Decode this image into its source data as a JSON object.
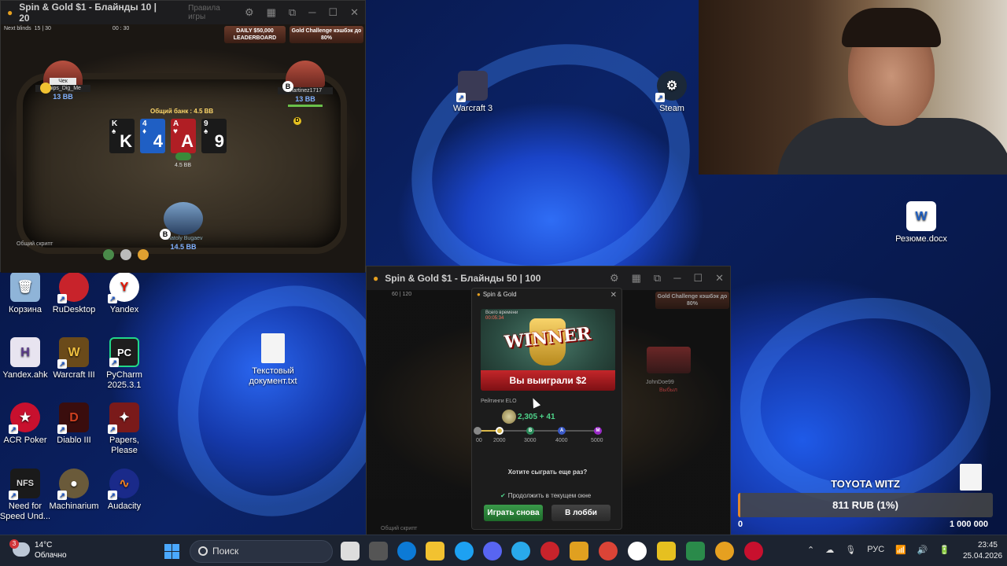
{
  "poker_window_1": {
    "title": "Spin & Gold $1 - Блайнды 10 | 20",
    "rules_link": "Правила игры",
    "next_blinds_label": "Next blinds",
    "next_blinds_value": "15 | 30",
    "timer": "00 : 30",
    "promo_1": "DAILY $50,000 LEADERBOARD",
    "promo_2": "Gold Challenge кэшбэк до 80%",
    "pot": "Общий банк : 4.5 BB",
    "players": [
      {
        "name": "Chips_Dig_Me",
        "stack": "13 BB",
        "action": "Чек"
      },
      {
        "name": "martinez1717",
        "stack": "13 BB"
      },
      {
        "name": "Anatoly Bugaev",
        "stack": "14.5 BB"
      }
    ],
    "board": [
      {
        "rank": "K",
        "suit": "♠",
        "color": "#1a1a1a"
      },
      {
        "rank": "4",
        "suit": "♦",
        "color": "#1f5fc4"
      },
      {
        "rank": "A",
        "suit": "♥",
        "color": "#b01e24"
      },
      {
        "rank": "9",
        "suit": "♠",
        "color": "#1a1a1a"
      }
    ],
    "bet": "4.5 BB",
    "chat_label": "Общий скрипт"
  },
  "desktop_icons": [
    {
      "label": "Warcraft 3",
      "color": "#3a3a55"
    },
    {
      "label": "Steam",
      "color": "#1b2838"
    },
    {
      "label": "Резюме.docx",
      "color": "#1e5fc2"
    },
    {
      "label": "Корзина",
      "color": "#8fb4d8"
    },
    {
      "label": "RuDesktop",
      "color": "#c8232b"
    },
    {
      "label": "Yandex",
      "color": "#ffffff"
    },
    {
      "label": "Yandex.ahk",
      "color": "#e8e4f0"
    },
    {
      "label": "Warcraft III",
      "color": "#6a4a1a"
    },
    {
      "label": "PyCharm 2025.3.1",
      "color": "#1e1e1e"
    },
    {
      "label": "Текстовый документ.txt",
      "color": "#f4f4f4"
    },
    {
      "label": "ACR Poker",
      "color": "#c8102e"
    },
    {
      "label": "Diablo III",
      "color": "#3a0d0d"
    },
    {
      "label": "Papers, Please",
      "color": "#7a1a1a"
    },
    {
      "label": "Need for Speed Und...",
      "color": "#1a1a1a"
    },
    {
      "label": "Machinarium",
      "color": "#6a5a3a"
    },
    {
      "label": "Audacity",
      "color": "#1a2a8a"
    }
  ],
  "poker_window_2": {
    "title": "Spin & Gold $1 - Блайнды 50 | 100",
    "blinds_value": "60 | 120",
    "promo": "Gold Challenge кэшбэк до 80%",
    "opponent": "JohnDoe99",
    "opponent_status": "Выбыл",
    "chat_label": "Общий скрипт"
  },
  "result_dialog": {
    "title": "Spin & Gold",
    "banner_label": "Всего времени",
    "banner_time": "00:05:34",
    "winner_text": "WINNER",
    "won_text": "Вы выиграли $2",
    "elo_label": "Рейтинги ELO",
    "elo_value": "2,305 + 41",
    "elo_fraction": 0.19,
    "elo_ticks": [
      "00",
      "2000",
      "3000",
      "4000",
      "5000"
    ],
    "elo_nodes": [
      "B",
      "A",
      "M"
    ],
    "question": "Хотите сыграть еще раз?",
    "stay_option": "Продолжить в текущем окне",
    "play_again": "Играть снова",
    "to_lobby": "В лобби"
  },
  "stream_goal": {
    "title": "TOYOTA WITZ",
    "progress_text": "811 RUB (1%)",
    "progress_fraction": 0.01,
    "min": "0",
    "max": "1 000 000",
    "accent": "#e0872a"
  },
  "taskbar": {
    "weather_temp": "14°C",
    "weather_desc": "Облачно",
    "weather_badge": "3",
    "search_placeholder": "Поиск",
    "language": "РУС",
    "time": "23:45",
    "date": "25.04.2026"
  }
}
